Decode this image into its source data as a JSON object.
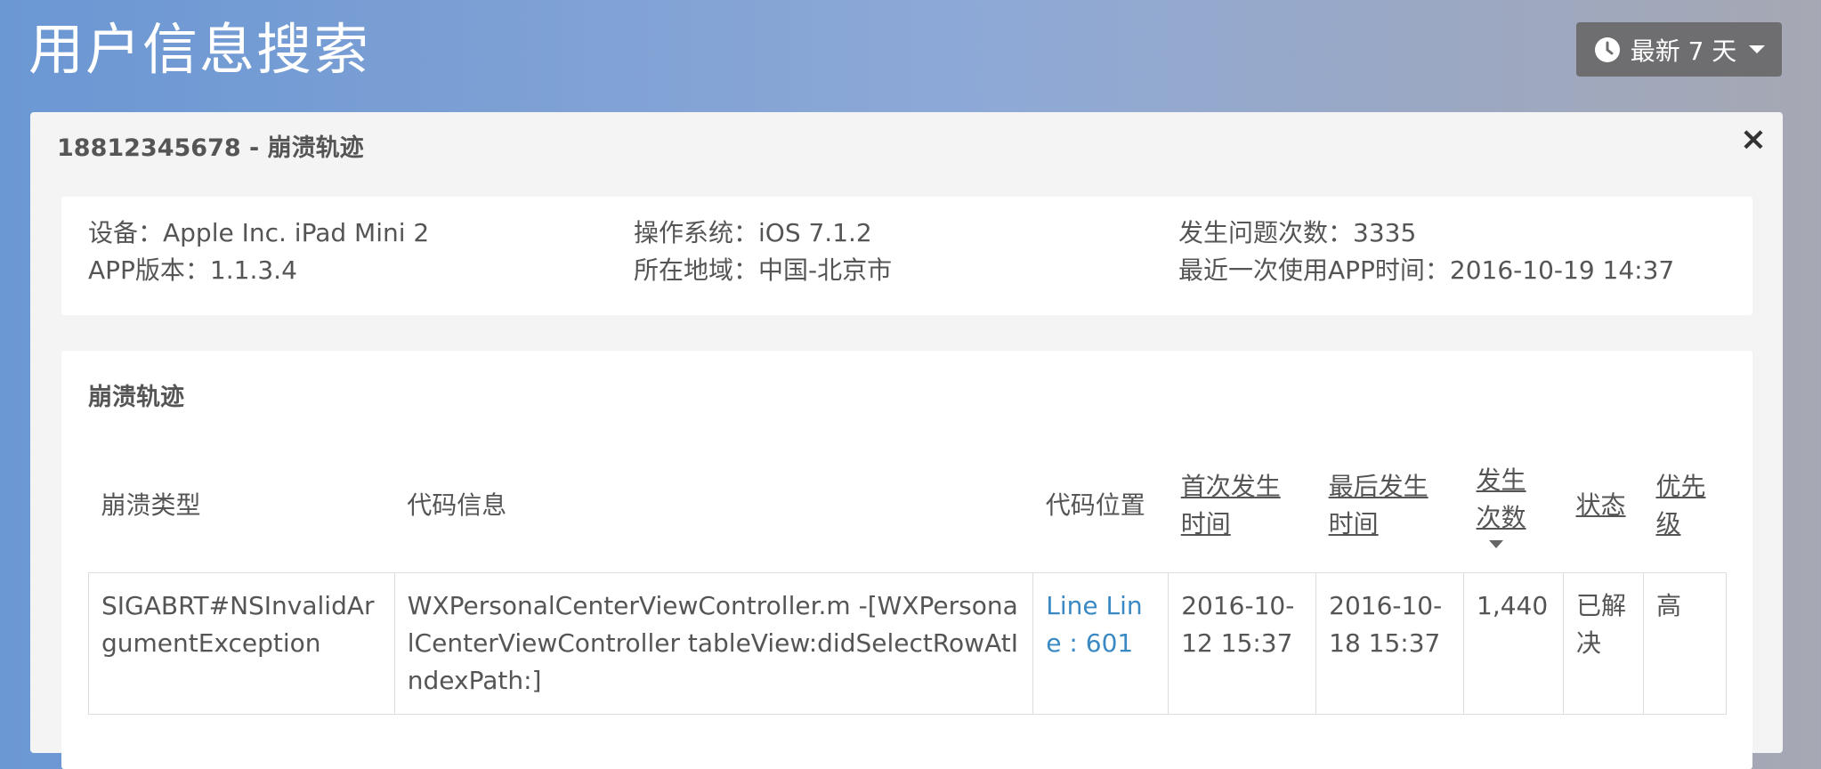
{
  "header": {
    "title": "用户信息搜索",
    "range_label": "最新 7 天"
  },
  "modal": {
    "title": "18812345678 - 崩溃轨迹",
    "close_label": "×",
    "info": {
      "device": "设备：Apple Inc. iPad Mini 2",
      "app_version": "APP版本：1.1.3.4",
      "os": "操作系统：iOS 7.1.2",
      "location": "所在地域：中国-北京市",
      "issue_count": "发生问题次数：3335",
      "last_used": "最近一次使用APP时间：2016-10-19 14:37"
    },
    "panel_title": "崩溃轨迹",
    "table": {
      "headers": {
        "crash_type": "崩溃类型",
        "code_info": "代码信息",
        "code_location": "代码位置",
        "first_time": "首次发生时间",
        "last_time": "最后发生时间",
        "count": "发生次数",
        "status": "状态",
        "priority": "优先级"
      },
      "rows": [
        {
          "crash_type": "SIGABRT#NSInvalidArgumentException",
          "code_info": "WXPersonalCenterViewController.m -[WXPersonalCenterViewController tableView:didSelectRowAtIndexPath:]",
          "code_location": "Line Line : 601",
          "first_time": "2016-10-12 15:37",
          "last_time": "2016-10-18 15:37",
          "count": "1,440",
          "status": "已解决",
          "priority": "高"
        }
      ]
    }
  },
  "colors": {
    "accent_link": "#3a89c4",
    "button_bg": "#6e6e71"
  }
}
